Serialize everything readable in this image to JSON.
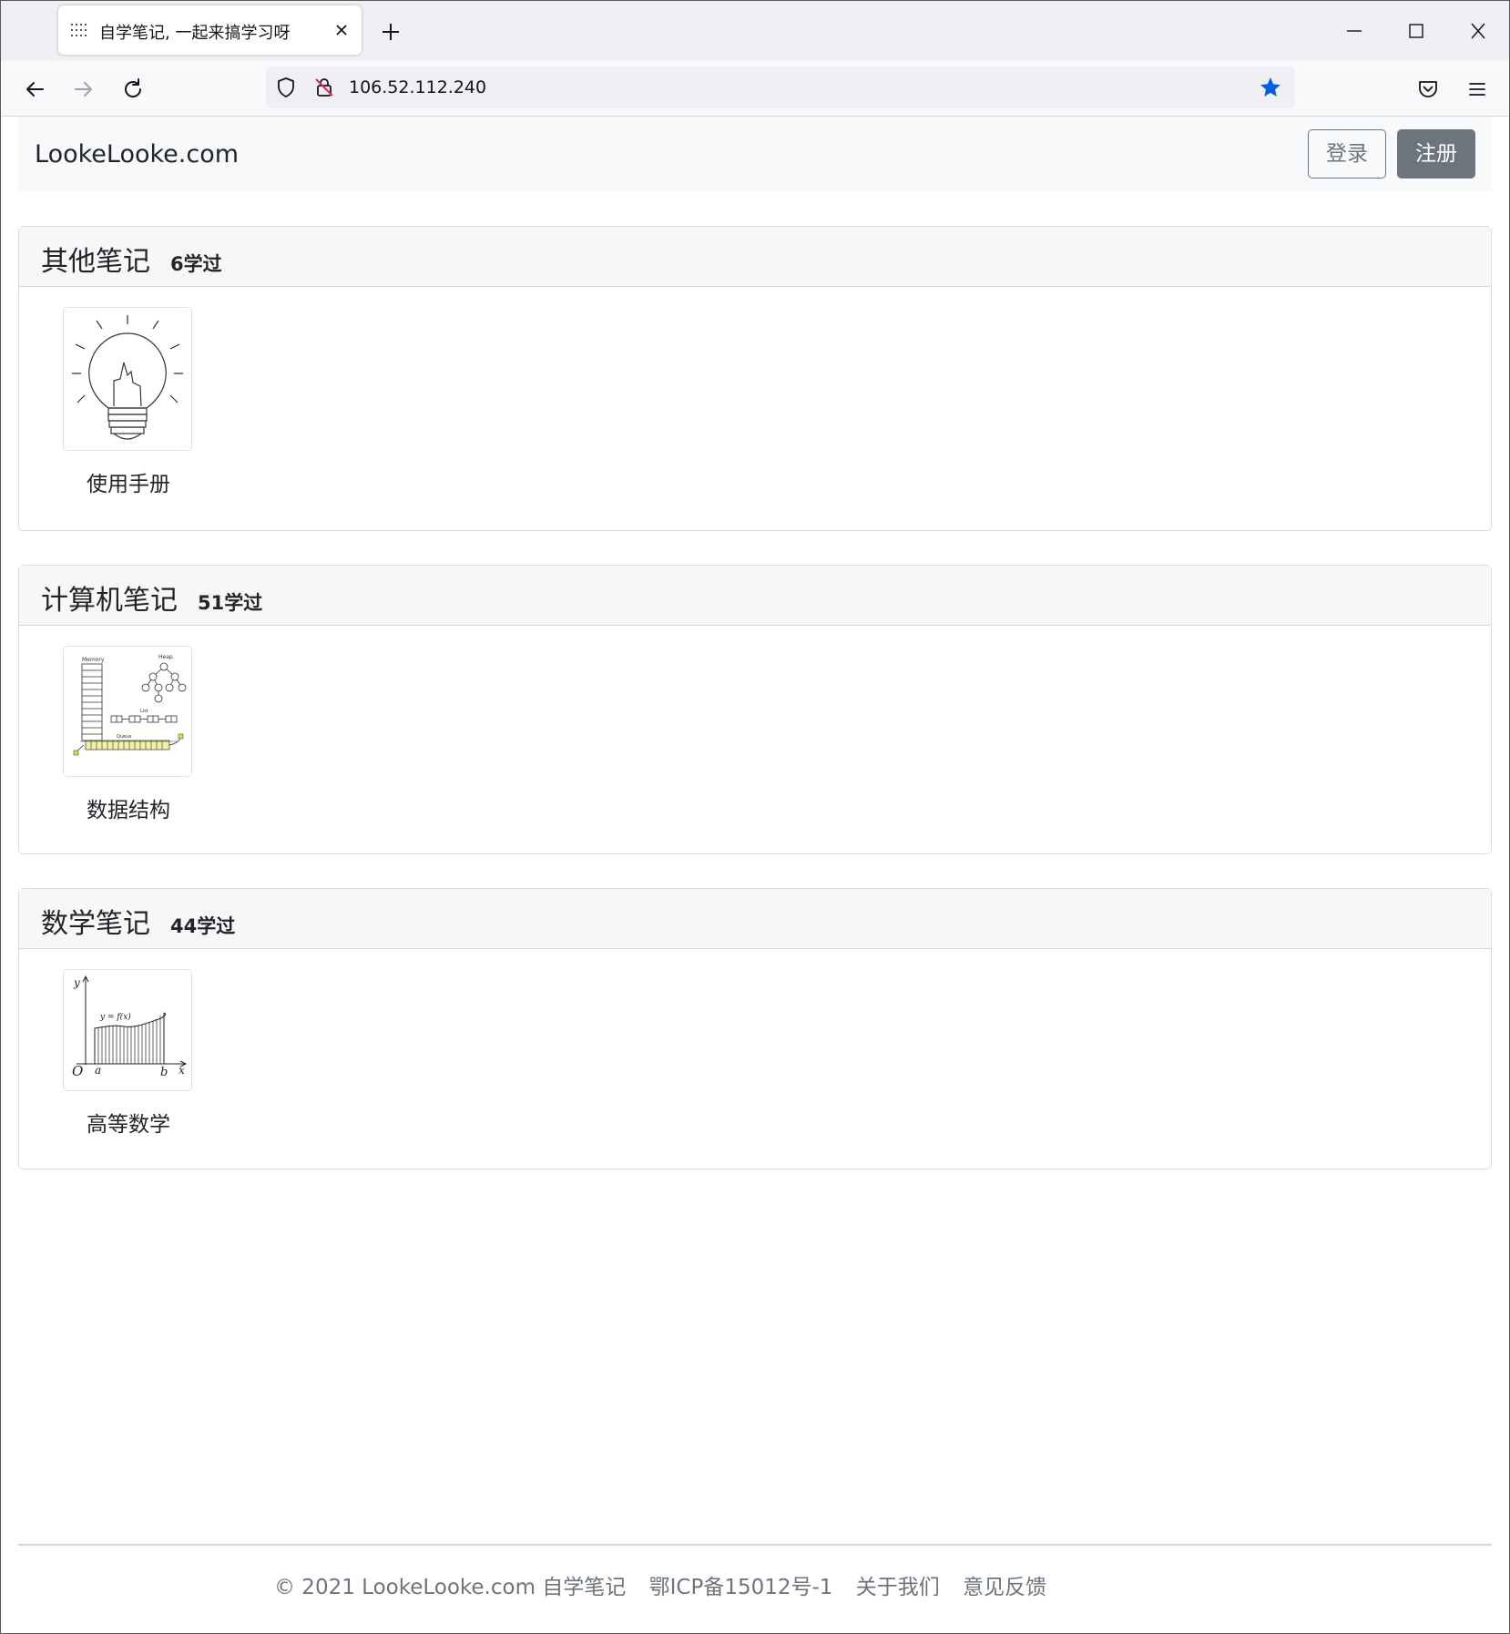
{
  "browser": {
    "tab_title": "自学笔记, 一起来搞学习呀",
    "url": "106.52.112.240",
    "icons": [
      "page-favicon-icon",
      "close-tab-icon",
      "new-tab-icon",
      "minimize-icon",
      "maximize-icon",
      "close-window-icon",
      "back-icon",
      "forward-icon",
      "reload-icon",
      "shield-icon",
      "insecure-lock-icon",
      "bookmark-star-icon",
      "pocket-icon",
      "menu-icon"
    ],
    "accent_color": "#0061e0"
  },
  "site": {
    "brand": "LookeLooke.com",
    "login_label": "登录",
    "register_label": "注册"
  },
  "sections": [
    {
      "title": "其他笔记",
      "count": "6学过",
      "items": [
        {
          "label": "使用手册",
          "icon": "lightbulb-icon"
        }
      ]
    },
    {
      "title": "计算机笔记",
      "count": "51学过",
      "items": [
        {
          "label": "数据结构",
          "icon": "data-structure-diagram-icon"
        }
      ]
    },
    {
      "title": "数学笔记",
      "count": "44学过",
      "items": [
        {
          "label": "高等数学",
          "icon": "integral-graph-icon"
        }
      ]
    }
  ],
  "thumb_text": {
    "memory": "Memory",
    "heap": "Heap",
    "list": "List",
    "queue": "Queue",
    "y": "y",
    "fx": "y = f(x)",
    "o": "O",
    "a": "a",
    "b": "b",
    "x": "x"
  },
  "footer": {
    "copyright": "© 2021 LookeLooke.com 自学笔记",
    "icp": "鄂ICP备15012号-1",
    "about": "关于我们",
    "feedback": "意见反馈"
  }
}
